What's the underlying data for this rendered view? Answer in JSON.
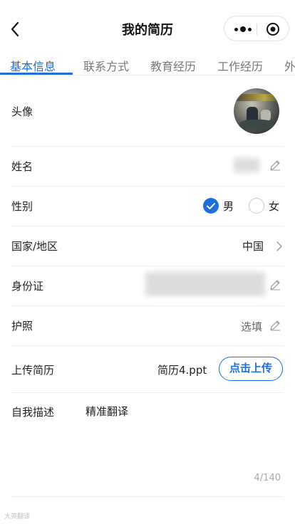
{
  "header": {
    "title": "我的简历"
  },
  "tabs": [
    "基本信息",
    "联系方式",
    "教育经历",
    "工作经历",
    "外"
  ],
  "form": {
    "avatar_label": "头像",
    "name_label": "姓名",
    "gender_label": "性别",
    "gender_male": "男",
    "gender_female": "女",
    "gender_selected": "男",
    "country_label": "国家/地区",
    "country_value": "中国",
    "id_label": "身份证",
    "passport_label": "护照",
    "passport_placeholder": "选填",
    "resume_label": "上传简历",
    "resume_file": "简历4.ppt",
    "upload_button": "点击上传",
    "desc_label": "自我描述",
    "desc_value": "精准翻译",
    "desc_counter": "4/140"
  },
  "watermark": "大英翻译",
  "colors": {
    "accent": "#1e6fd9"
  }
}
